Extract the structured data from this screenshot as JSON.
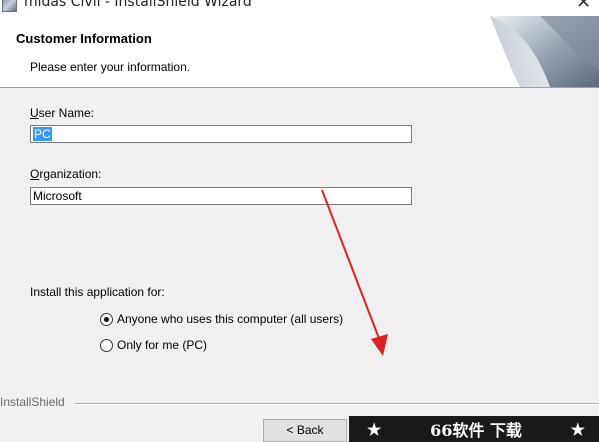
{
  "window": {
    "title": "midas Civil - InstallShield Wizard",
    "close_glyph": "✕"
  },
  "header": {
    "title": "Customer Information",
    "subtitle": "Please enter your information."
  },
  "form": {
    "user_name_label_prefix": "U",
    "user_name_label_rest": "ser Name:",
    "user_name_value": "PC",
    "organization_label_prefix": "O",
    "organization_label_rest": "rganization:",
    "organization_value": "Microsoft"
  },
  "install_for": {
    "label": "Install this application for:",
    "options": [
      {
        "label": "Anyone who uses this computer (all users)",
        "selected": true
      },
      {
        "label": "Only for me (PC)",
        "selected": false
      }
    ]
  },
  "footer": {
    "brand": "InstallShield",
    "back_label": "< Back"
  },
  "watermark": {
    "left_star": "★",
    "text": "66软件 下载",
    "right_star": "★"
  },
  "colors": {
    "dialog_bg": "#f0f0f0",
    "selection": "#3399ff",
    "annotation_arrow": "#e02020"
  },
  "icons": [
    "app-icon",
    "close-icon",
    "banner-art",
    "radio-checked",
    "radio-unchecked",
    "annotation-arrow"
  ]
}
